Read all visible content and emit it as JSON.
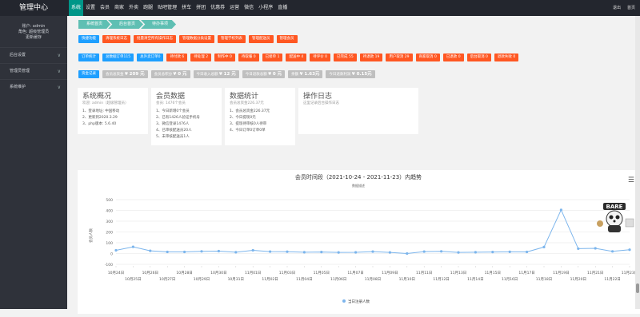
{
  "app": {
    "title": "管理中心"
  },
  "nav": [
    "系统",
    "设置",
    "会员",
    "商家",
    "外卖",
    "跑腿",
    "贴吧管理",
    "拼车",
    "拼团",
    "优惠券",
    "运营",
    "微信",
    "小程序",
    "直播"
  ],
  "top_right": {
    "logout": "退出",
    "home": "首页"
  },
  "user": {
    "account": "账户: admin",
    "role": "角色: 超级管理员",
    "change_pwd": "更新缓存"
  },
  "sidebar": [
    "后台设置",
    "管理员管理",
    "系统维护"
  ],
  "breadcrumbs": [
    "系统首页",
    "后台首页",
    "待办事项"
  ],
  "row1": [
    {
      "label": "快捷功能",
      "color": "blue"
    },
    {
      "label": "清理系统日志",
      "color": "orange"
    },
    {
      "label": "批量清空所有操作日志",
      "color": "orange"
    },
    {
      "label": "管理数据分类设置",
      "color": "orange"
    },
    {
      "label": "管理学校列表",
      "color": "orange"
    },
    {
      "label": "管理配送员",
      "color": "orange"
    },
    {
      "label": "管理会员",
      "color": "orange"
    }
  ],
  "row2": [
    {
      "label": "订单统计",
      "color": "blue"
    },
    {
      "label": "总数据订单115",
      "color": "blue"
    },
    {
      "label": "总外卖订单0",
      "color": "blue"
    },
    {
      "label": "待付款 6",
      "color": "orange"
    },
    {
      "label": "待处理 2",
      "color": "orange"
    },
    {
      "label": "制作中 0",
      "color": "orange"
    },
    {
      "label": "待取餐 0",
      "color": "orange"
    },
    {
      "label": "已接单 1",
      "color": "orange"
    },
    {
      "label": "配送中 4",
      "color": "orange"
    },
    {
      "label": "待评价 0",
      "color": "orange"
    },
    {
      "label": "已完成 55",
      "color": "orange"
    },
    {
      "label": "待退款 19",
      "color": "orange"
    },
    {
      "label": "用户取消 29",
      "color": "orange"
    },
    {
      "label": "商家取消 0",
      "color": "orange"
    },
    {
      "label": "已退款 0",
      "color": "orange"
    },
    {
      "label": "后台取消 0",
      "color": "orange"
    },
    {
      "label": "退款失败 0",
      "color": "orange"
    }
  ],
  "row3": [
    {
      "label": "资金记录",
      "value": "",
      "color": "blue"
    },
    {
      "label": "会员总资金",
      "value": "¥ 209 元",
      "color": "gray"
    },
    {
      "label": "会员总积分",
      "value": "¥ 0 元",
      "color": "gray"
    },
    {
      "label": "今日收入总额",
      "value": "¥ 12 元",
      "color": "gray"
    },
    {
      "label": "今日退款总额",
      "value": "¥ 0 元",
      "color": "gray"
    },
    {
      "label": "余额",
      "value": "¥ 1.63元",
      "color": "gray"
    },
    {
      "label": "今日退款利润",
      "value": "¥ 0.15元",
      "color": "gray"
    }
  ],
  "cards": [
    {
      "title": "系统概况",
      "sub": "欢迎: admin（超级管理员）",
      "lines": [
        "1、登录地址: 中国移动",
        "2、更新到2020.3.29",
        "3、php版本: 5.6.40"
      ]
    },
    {
      "title": "会员数据",
      "sub": "会员: 1476个会员",
      "lines": [
        "1、今日新增0个会员",
        "2、已有1426人验证手机号",
        "3、微信登录1476人",
        "4、已审核配送员20人",
        "5、未审核配送员1人"
      ]
    },
    {
      "title": "数据统计",
      "sub": "会员总资金226.37元",
      "lines": [
        "1、会员总资金226.37元",
        "2、今日提现0元",
        "3、提现待审核0人待审",
        "4、今日订单0订单0单"
      ]
    },
    {
      "title": "操作日志",
      "sub": "这里记录后台操作日志",
      "lines": []
    }
  ],
  "chart_data": {
    "type": "line",
    "title": "会员时间段（2021-10-24 - 2021-11-23）内趋势",
    "subtitle": "数据描述",
    "ylabel": "会员人数",
    "ylim": [
      -100,
      500
    ],
    "yticks": [
      -100,
      0,
      100,
      200,
      300,
      400,
      500
    ],
    "categories": [
      "10月24日",
      "10月25日",
      "10月26日",
      "10月27日",
      "10月28日",
      "10月29日",
      "10月30日",
      "10月31日",
      "11月01日",
      "11月02日",
      "11月03日",
      "11月04日",
      "11月05日",
      "11月06日",
      "11月07日",
      "11月08日",
      "11月09日",
      "11月10日",
      "11月11日",
      "11月12日",
      "11月13日",
      "11月14日",
      "11月15日",
      "11月16日",
      "11月17日",
      "11月18日",
      "11月19日",
      "11月20日",
      "11月21日",
      "11月22日",
      "11月23日"
    ],
    "series": [
      {
        "name": "当日注册人数",
        "color": "#7cb5ec",
        "values": [
          30,
          62,
          25,
          15,
          15,
          20,
          22,
          12,
          30,
          18,
          17,
          12,
          14,
          10,
          11,
          18,
          10,
          0,
          18,
          20,
          10,
          12,
          14,
          16,
          15,
          60,
          405,
          45,
          48,
          20,
          35
        ]
      }
    ],
    "legend_position": "bottom",
    "grid": true
  },
  "chart_menu_icon": "menu-icon"
}
